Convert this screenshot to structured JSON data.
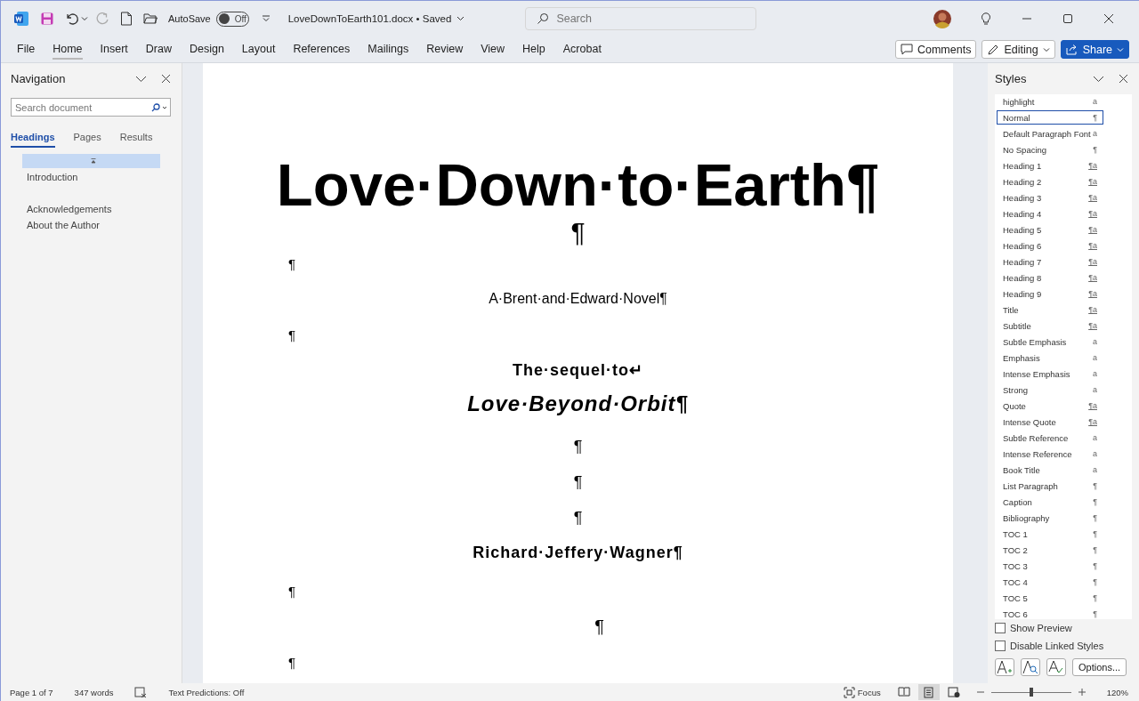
{
  "title_bar": {
    "autosave_label": "AutoSave",
    "autosave": {
      "on": false,
      "label": "Off"
    },
    "filename": "LoveDownToEarth101.docx • Saved",
    "search_placeholder": "Search"
  },
  "ribbon_tabs": [
    {
      "label": "File",
      "selected": false
    },
    {
      "label": "Home",
      "selected": true
    },
    {
      "label": "Insert",
      "selected": false
    },
    {
      "label": "Draw",
      "selected": false
    },
    {
      "label": "Design",
      "selected": false
    },
    {
      "label": "Layout",
      "selected": false
    },
    {
      "label": "References",
      "selected": false
    },
    {
      "label": "Mailings",
      "selected": false
    },
    {
      "label": "Review",
      "selected": false
    },
    {
      "label": "View",
      "selected": false
    },
    {
      "label": "Help",
      "selected": false
    },
    {
      "label": "Acrobat",
      "selected": false
    }
  ],
  "ribbon_buttons": {
    "comments": "Comments",
    "editing": "Editing",
    "share": "Share"
  },
  "navigation": {
    "title": "Navigation",
    "search_placeholder": "Search document",
    "tabs": [
      {
        "label": "Headings",
        "selected": true
      },
      {
        "label": "Pages",
        "selected": false
      },
      {
        "label": "Results",
        "selected": false
      }
    ],
    "headings": [
      {
        "selected": true,
        "collapse_mark": true
      },
      {
        "label": "Introduction",
        "selected": false
      },
      {
        "selected": false
      },
      {
        "label": "Acknowledgements",
        "selected": false
      },
      {
        "label": "About the Author",
        "selected": false
      }
    ]
  },
  "document": {
    "paragraphs": [
      {
        "kind": "title",
        "text": "Love·Down·to·Earth¶"
      },
      {
        "kind": "big-mark",
        "text": "¶"
      },
      {
        "kind": "left-mark",
        "text": "¶"
      },
      {
        "kind": "subtitle",
        "text": "A·Brent·and·Edward·Novel¶"
      },
      {
        "kind": "left-mark",
        "text": "¶"
      },
      {
        "kind": "sequel",
        "text": "The·sequel·to↵"
      },
      {
        "kind": "book",
        "text": "Love·Beyond·Orbit¶"
      },
      {
        "kind": "mark",
        "text": "¶"
      },
      {
        "kind": "mark",
        "text": "¶"
      },
      {
        "kind": "mark",
        "text": "¶"
      },
      {
        "kind": "author",
        "text": "Richard·Jeffery·Wagner¶"
      },
      {
        "kind": "left-mark",
        "text": "¶"
      },
      {
        "kind": "offset-mark",
        "text": "¶"
      },
      {
        "kind": "left-mark",
        "text": "¶"
      }
    ]
  },
  "styles": {
    "title": "Styles",
    "items": [
      {
        "name": "highlight",
        "marker": "a",
        "selected": false
      },
      {
        "name": "Normal",
        "marker": "¶",
        "selected": true
      },
      {
        "name": "Default Paragraph Font",
        "marker": "a",
        "selected": false
      },
      {
        "name": "No Spacing",
        "marker": "¶",
        "selected": false
      },
      {
        "name": "Heading 1",
        "marker": "¶a",
        "selected": false
      },
      {
        "name": "Heading 2",
        "marker": "¶a",
        "selected": false
      },
      {
        "name": "Heading 3",
        "marker": "¶a",
        "selected": false
      },
      {
        "name": "Heading 4",
        "marker": "¶a",
        "selected": false
      },
      {
        "name": "Heading 5",
        "marker": "¶a",
        "selected": false
      },
      {
        "name": "Heading 6",
        "marker": "¶a",
        "selected": false
      },
      {
        "name": "Heading 7",
        "marker": "¶a",
        "selected": false
      },
      {
        "name": "Heading 8",
        "marker": "¶a",
        "selected": false
      },
      {
        "name": "Heading 9",
        "marker": "¶a",
        "selected": false
      },
      {
        "name": "Title",
        "marker": "¶a",
        "selected": false
      },
      {
        "name": "Subtitle",
        "marker": "¶a",
        "selected": false
      },
      {
        "name": "Subtle Emphasis",
        "marker": "a",
        "selected": false
      },
      {
        "name": "Emphasis",
        "marker": "a",
        "selected": false
      },
      {
        "name": "Intense Emphasis",
        "marker": "a",
        "selected": false
      },
      {
        "name": "Strong",
        "marker": "a",
        "selected": false
      },
      {
        "name": "Quote",
        "marker": "¶a",
        "selected": false
      },
      {
        "name": "Intense Quote",
        "marker": "¶a",
        "selected": false
      },
      {
        "name": "Subtle Reference",
        "marker": "a",
        "selected": false
      },
      {
        "name": "Intense Reference",
        "marker": "a",
        "selected": false
      },
      {
        "name": "Book Title",
        "marker": "a",
        "selected": false
      },
      {
        "name": "List Paragraph",
        "marker": "¶",
        "selected": false
      },
      {
        "name": "Caption",
        "marker": "¶",
        "selected": false
      },
      {
        "name": "Bibliography",
        "marker": "¶",
        "selected": false
      },
      {
        "name": "TOC 1",
        "marker": "¶",
        "selected": false
      },
      {
        "name": "TOC 2",
        "marker": "¶",
        "selected": false
      },
      {
        "name": "TOC 3",
        "marker": "¶",
        "selected": false
      },
      {
        "name": "TOC 4",
        "marker": "¶",
        "selected": false
      },
      {
        "name": "TOC 5",
        "marker": "¶",
        "selected": false
      },
      {
        "name": "TOC 6",
        "marker": "¶",
        "selected": false
      }
    ],
    "options": [
      {
        "label": "Show Preview",
        "checked": false
      },
      {
        "label": "Disable Linked Styles",
        "checked": false
      }
    ],
    "options_button": "Options..."
  },
  "status_bar": {
    "page": "Page 1 of 7",
    "words": "347 words",
    "predictions": "Text Predictions: Off",
    "focus": "Focus",
    "views": [
      {
        "kind": "read",
        "selected": false
      },
      {
        "kind": "print",
        "selected": true
      },
      {
        "kind": "web",
        "selected": false
      }
    ],
    "zoom": {
      "level": 0.5,
      "label": "120%"
    }
  }
}
